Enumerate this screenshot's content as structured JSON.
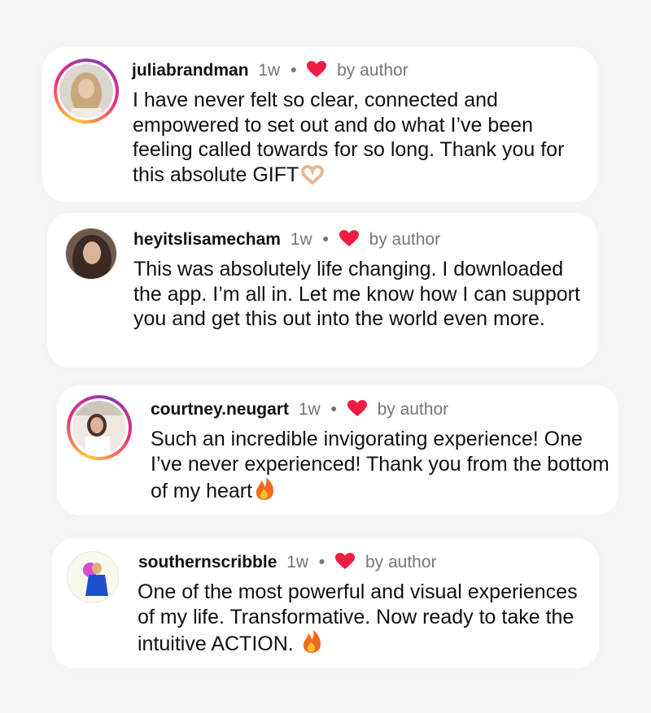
{
  "accent": {
    "heart": "#ed1d43",
    "ring_start": "#f9ce34",
    "ring_mid": "#ee2a7b",
    "ring_end": "#8a3ab9"
  },
  "comments": [
    {
      "username": "juliabrandman",
      "time": "1w",
      "separator": "•",
      "liked_label": "by author",
      "text": "I have never felt so clear, connected and empowered to set out and do what I’ve been feeling called towards for so long. Thank you for this absolute GIFT",
      "emoji": "heart-hands-emoji",
      "story_ring": true
    },
    {
      "username": "heyitslisamecham",
      "time": "1w",
      "separator": "•",
      "liked_label": "by author",
      "text": "This was absolutely life changing. I downloaded the app. I’m all in. Let me know how I can support you and get this out into the world even more.",
      "emoji": "",
      "story_ring": false
    },
    {
      "username": "courtney.neugart",
      "time": "1w",
      "separator": "•",
      "liked_label": "by author",
      "text": "Such an incredible invigorating experience! One I’ve never experienced! Thank you from the bottom of my heart",
      "emoji": "fire-emoji",
      "story_ring": true
    },
    {
      "username": "southernscribble",
      "time": "1w",
      "separator": "•",
      "liked_label": "by author",
      "text": "One of the most powerful and visual experiences of my life. Transformative. Now ready to take the intuitive ACTION.",
      "emoji": "fire-emoji",
      "story_ring": false
    }
  ]
}
